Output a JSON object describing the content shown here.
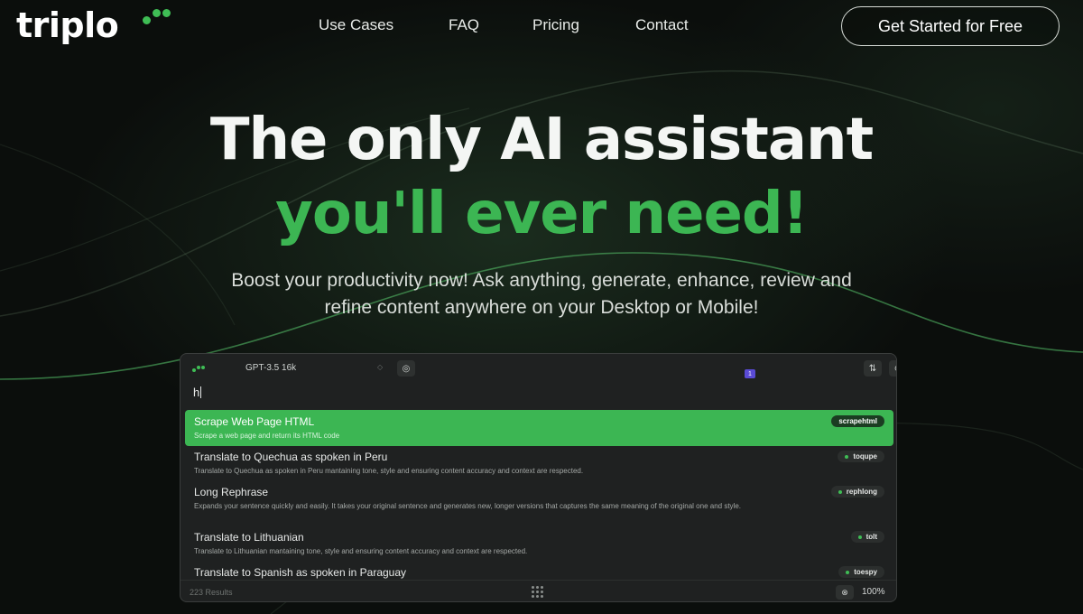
{
  "brand": {
    "name": "triplo",
    "accent": "#3cb653"
  },
  "nav": {
    "items": [
      "Use Cases",
      "FAQ",
      "Pricing",
      "Contact"
    ],
    "cta": "Get Started for Free"
  },
  "hero": {
    "title_line1": "The only AI assistant",
    "title_line2": "you'll ever need!",
    "subtitle_line1": "Boost your productivity now! Ask anything, generate, enhance, review and",
    "subtitle_line2": "refine content anywhere on your Desktop or Mobile!"
  },
  "app": {
    "model": "GPT-3.5 16k",
    "badge": "1",
    "query": "h",
    "items": [
      {
        "title": "Scrape Web Page HTML",
        "desc": "Scrape a web page and return its HTML code",
        "cmd": "scrapehtml",
        "active": true
      },
      {
        "title": "Translate to Quechua as spoken in Peru",
        "desc": "Translate to Quechua as spoken in Peru mantaining tone, style and ensuring content accuracy and context are respected.",
        "cmd": "toqupe",
        "active": false
      },
      {
        "title": "Long Rephrase",
        "desc": "Expands your sentence quickly and easily. It takes your original sentence and generates new, longer versions that captures the same meaning of the original one and style.",
        "cmd": "rephlong",
        "active": false
      },
      {
        "title": "Translate to Lithuanian",
        "desc": "Translate to Lithuanian mantaining tone, style and ensuring content accuracy and context are respected.",
        "cmd": "tolt",
        "active": false
      },
      {
        "title": "Translate to Spanish as spoken in Paraguay",
        "desc": "",
        "cmd": "toespy",
        "active": false
      }
    ],
    "results": "223 Results",
    "zoom": "100%",
    "icons": {
      "brand": "triplo-dots-icon",
      "prompt": "target-icon",
      "settings": "sliders-icon",
      "globe": "globe-icon",
      "agents": "agents-icon",
      "sparkle": "sparkle-icon",
      "magic": "magic-wand-icon",
      "history": "history-icon",
      "disable": "no-eye-icon",
      "grid": "grid-dots-icon",
      "mute": "mute-icon"
    }
  }
}
